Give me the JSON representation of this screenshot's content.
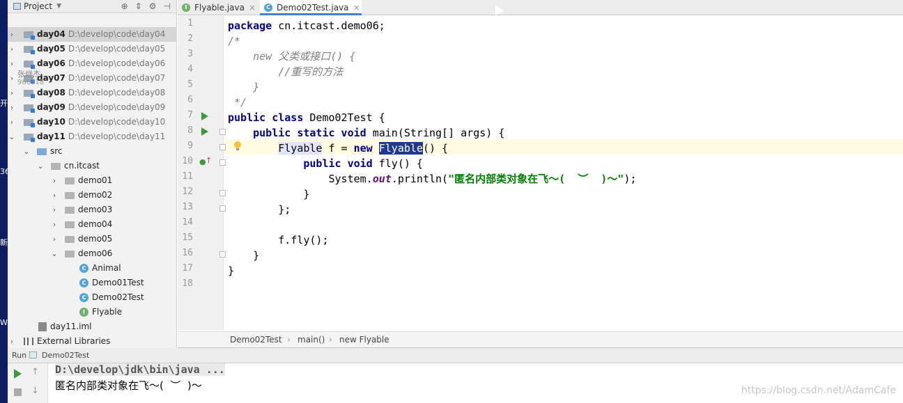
{
  "project_panel": {
    "title": "Project",
    "tools": [
      "⊕",
      "⇕",
      "⚙",
      "⊣"
    ],
    "items": [
      {
        "label": "day04",
        "path": "D:\\develop\\code\\day04"
      },
      {
        "label": "day05",
        "path": "D:\\develop\\code\\day05"
      },
      {
        "label": "day06",
        "path": "D:\\develop\\code\\day06"
      },
      {
        "label": "day07",
        "path": "D:\\develop\\code\\day07"
      },
      {
        "label": "day08",
        "path": "D:\\develop\\code\\day08"
      },
      {
        "label": "day09",
        "path": "D:\\develop\\code\\day09"
      },
      {
        "label": "day10",
        "path": "D:\\develop\\code\\day10"
      },
      {
        "label": "day11",
        "path": "D:\\develop\\code\\day11"
      }
    ],
    "src": "src",
    "package": "cn.itcast",
    "packages": [
      "demo01",
      "demo02",
      "demo03",
      "demo04",
      "demo05",
      "demo06"
    ],
    "classes": [
      "Animal",
      "Demo01Test",
      "Demo02Test",
      "Flyable"
    ],
    "iml": "day11.iml",
    "external": "External Libraries",
    "overlay_name": "张继杰",
    "overlay_id": "986318"
  },
  "edge_text": [
    "开",
    "36",
    "新",
    "W"
  ],
  "tabs": [
    {
      "label": "Flyable.java",
      "icon": "I"
    },
    {
      "label": "Demo02Test.java",
      "icon": "C"
    }
  ],
  "line_numbers": [
    "1",
    "2",
    "3",
    "4",
    "5",
    "6",
    "7",
    "8",
    "9",
    "10",
    "11",
    "12",
    "13",
    "14",
    "15",
    "16",
    "17",
    "18"
  ],
  "code": {
    "l1_kw": "package",
    "l1_rest": " cn.itcast.demo06;",
    "l2": "/*",
    "l3": "    new 父类或接口() {",
    "l4": "        //重写的方法",
    "l5": "    }",
    "l6": " */",
    "l7_kw": "public class",
    "l7_rest": " Demo02Test {",
    "l8_kw": "    public static void",
    "l8_rest": " main(String[] args) {",
    "l9_a": "        ",
    "l9_type": "Flyable",
    "l9_b": " f = ",
    "l9_new": "new",
    "l9_c": " ",
    "l9_sel": "Flyable",
    "l9_d": "() {",
    "l10_kw": "            public void",
    "l10_rest": " fly() {",
    "l11_a": "                System.",
    "l11_out": "out",
    "l11_b": ".println(",
    "l11_str": "\"匿名内部类对象在飞～(  ︶  )～\"",
    "l11_c": ");",
    "l12": "            }",
    "l13": "        };",
    "l14": "",
    "l15": "        f.fly();",
    "l16": "    }",
    "l17": "}",
    "l18": ""
  },
  "breadcrumb": [
    "Demo02Test",
    "main()",
    "new Flyable"
  ],
  "run": {
    "label": "Run",
    "config": "Demo02Test",
    "command": "D:\\develop\\jdk\\bin\\java ...",
    "output": "匿名内部类对象在飞～(  ︶  )～"
  },
  "watermark": "https://blog.csdn.net/AdamCafe"
}
